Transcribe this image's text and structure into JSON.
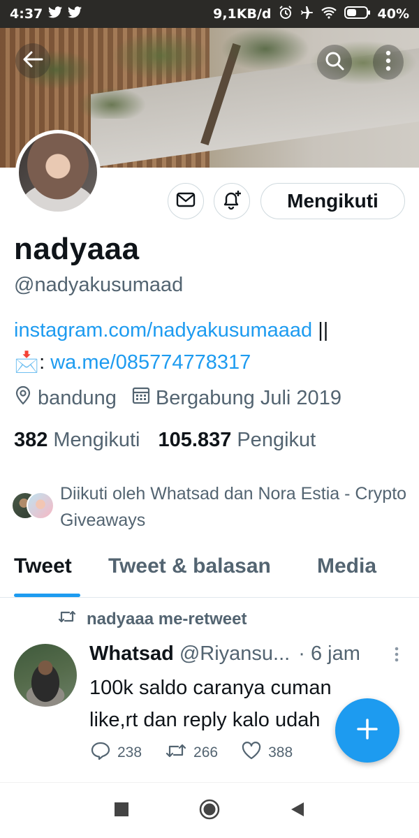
{
  "status_bar": {
    "time": "4:37",
    "speed": "9,1KB/d",
    "battery": "40%",
    "icons": [
      "twitter-icon",
      "twitter-icon",
      "alarm-icon",
      "airplane-icon",
      "wifi-icon",
      "battery-icon"
    ]
  },
  "profile": {
    "name": "nadyaaa",
    "handle": "@nadyakusumaad",
    "follow_button": "Mengikuti",
    "bio_link": "instagram.com/nadyakusumaaad",
    "bio_separator": " ||",
    "bio_emoji": "📩",
    "bio_colon": ": ",
    "bio_wa": "wa.me/085774778317",
    "location": "bandung",
    "joined": "Bergabung Juli 2019",
    "following_count": "382",
    "following_label": "Mengikuti",
    "followers_count": "105.837",
    "followers_label": "Pengikut",
    "followed_by": "Diikuti oleh Whatsad dan Nora Estia - Crypto Giveaways"
  },
  "tabs": [
    {
      "label": "Tweet",
      "active": true
    },
    {
      "label": "Tweet & balasan",
      "active": false
    },
    {
      "label": "Media",
      "active": false
    }
  ],
  "tweet": {
    "retweet_label": "nadyaaa me-retweet",
    "author_name": "Whatsad",
    "author_handle": "@Riyansu...",
    "time": "· 6 jam",
    "line1": "100k saldo caranya cuman",
    "line2": "like,rt dan reply kalo udah",
    "replies": "238",
    "retweets": "266",
    "likes": "388"
  },
  "colors": {
    "accent": "#1d9bf0",
    "text": "#0f1419",
    "secondary": "#536471",
    "border": "#cfd9de",
    "status_bar": "#2b2a27"
  }
}
